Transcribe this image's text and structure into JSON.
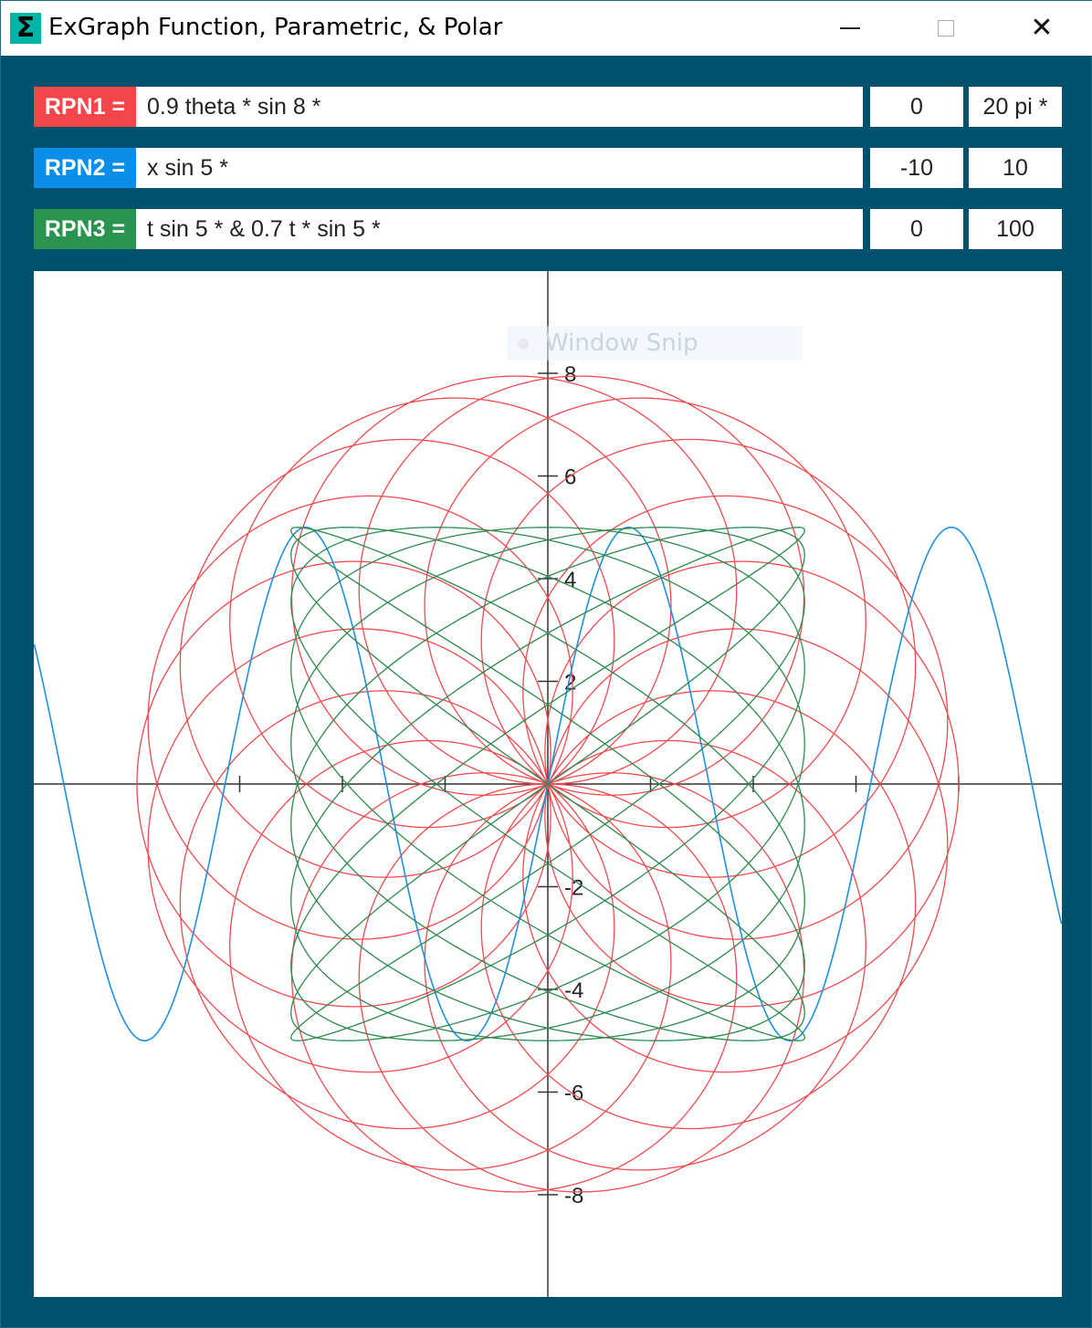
{
  "window": {
    "title": "ExGraph Function, Parametric, & Polar",
    "icon": "sigma-icon",
    "controls": {
      "minimize": "minimize-icon",
      "maximize": "maximize-icon",
      "close": "close-icon"
    }
  },
  "colors": {
    "background": "#00516d",
    "rpn1": "#f4454a",
    "rpn2": "#0a8ee8",
    "rpn3": "#2a9350",
    "curve1": "#ef4a4e",
    "curve2": "#1e90e0",
    "curve3": "#2e8b4e",
    "axis": "#333333"
  },
  "equations": [
    {
      "label": "RPN1 =",
      "expression": "0.9 theta * sin 8 *",
      "min": "0",
      "max": "20 pi *"
    },
    {
      "label": "RPN2 =",
      "expression": "x sin 5 *",
      "min": "-10",
      "max": "10"
    },
    {
      "label": "RPN3 =",
      "expression": "t sin 5 * & 0.7 t * sin 5 *",
      "min": "0",
      "max": "100"
    }
  ],
  "overlay": {
    "text": "Window Snip"
  },
  "chart_data": {
    "type": "line",
    "xlim": [
      -10,
      10
    ],
    "ylim": [
      -10,
      10
    ],
    "y_tick_labels": [
      "8",
      "6",
      "4",
      "2",
      "-2",
      "-4",
      "-6",
      "-8"
    ],
    "y_tick_values": [
      8,
      6,
      4,
      2,
      -2,
      -4,
      -6,
      -8
    ],
    "x_tick_values": [
      -6,
      -4,
      -2,
      2,
      4,
      6,
      8
    ],
    "series": [
      {
        "kind": "polar",
        "r": "8*sin(0.9*theta)",
        "range": [
          0,
          62.832
        ]
      },
      {
        "kind": "function",
        "y": "5*sin(x)",
        "range": [
          -10,
          10
        ]
      },
      {
        "kind": "parametric",
        "x": "5*sin(t)",
        "y": "5*sin(0.7*t)",
        "range": [
          0,
          100
        ]
      }
    ]
  }
}
